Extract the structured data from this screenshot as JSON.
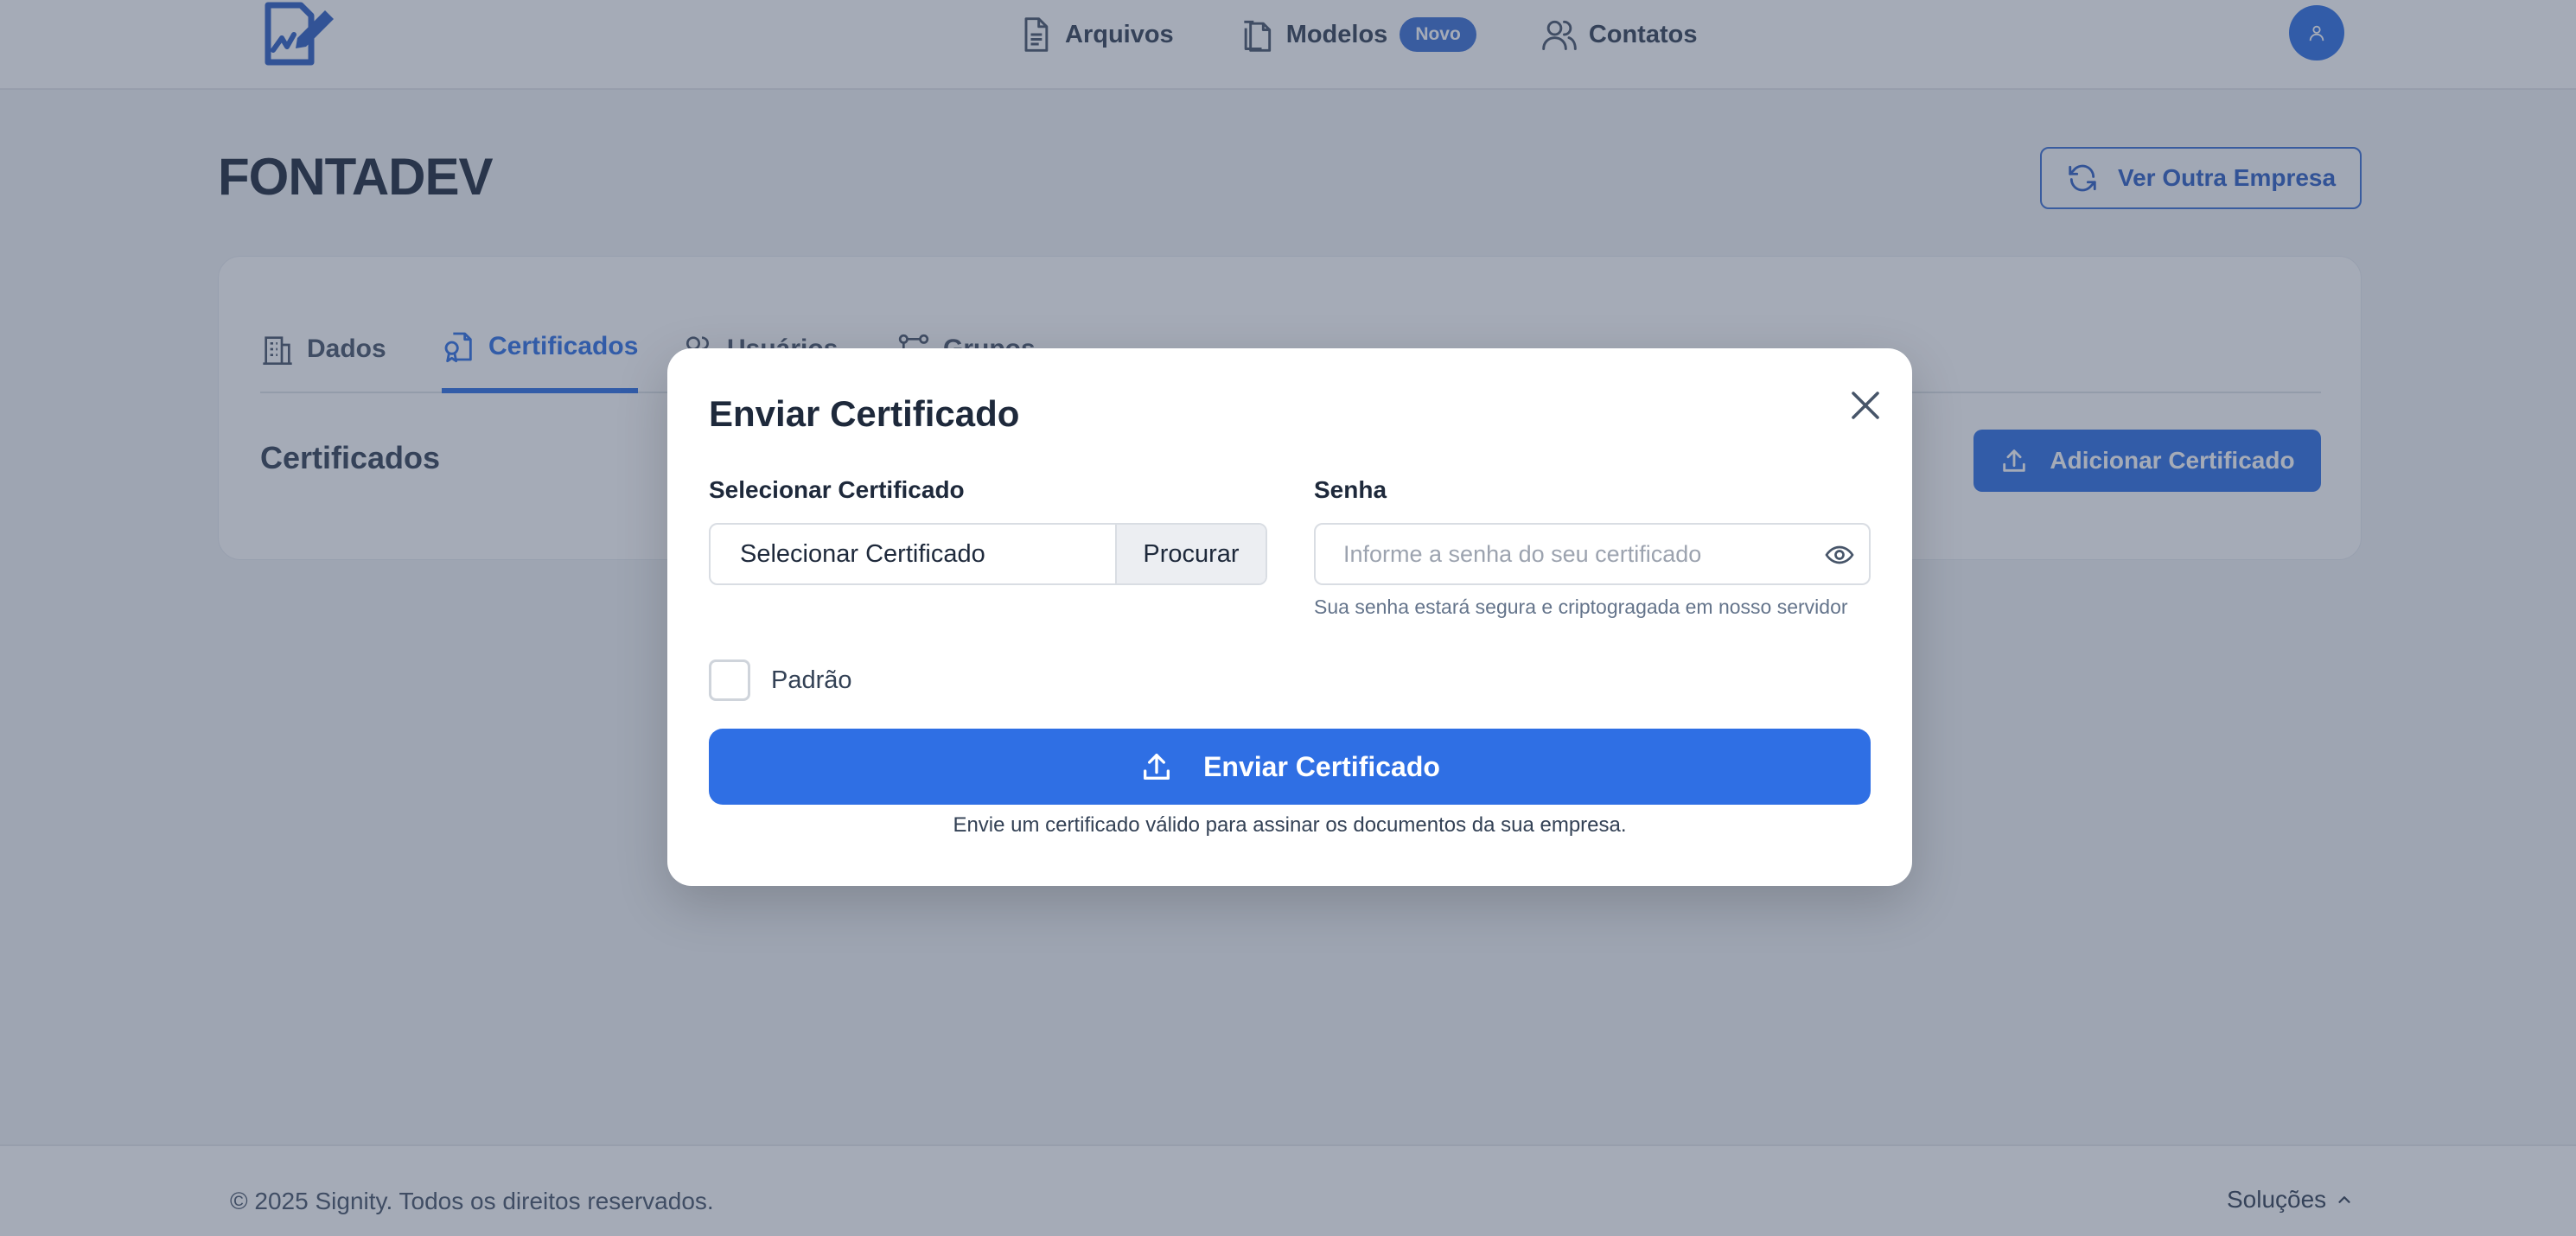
{
  "header": {
    "nav": [
      {
        "label": "Arquivos",
        "icon": "document-icon"
      },
      {
        "label": "Modelos",
        "icon": "documents-icon",
        "badge": "Novo"
      },
      {
        "label": "Contatos",
        "icon": "users-icon"
      }
    ]
  },
  "page": {
    "company_name": "FONTADEV",
    "switch_company_label": "Ver Outra Empresa",
    "tabs": [
      {
        "label": "Dados",
        "icon": "building-icon"
      },
      {
        "label": "Certificados",
        "icon": "certificate-icon",
        "active": true
      },
      {
        "label": "Usuários",
        "icon": "users-icon"
      },
      {
        "label": "Grupos",
        "icon": "groups-icon"
      }
    ],
    "section_title": "Certificados",
    "add_certificate_label": "Adicionar Certificado"
  },
  "modal": {
    "title": "Enviar Certificado",
    "certificate_label": "Selecionar Certificado",
    "file_value": "Selecionar Certificado",
    "browse_label": "Procurar",
    "password_label": "Senha",
    "password_placeholder": "Informe a senha do seu certificado",
    "password_hint": "Sua senha estará segura e criptogragada em nosso servidor",
    "default_label": "Padrão",
    "default_checked": false,
    "submit_label": "Enviar Certificado",
    "note": "Envie um certificado válido para assinar os documentos da sua empresa."
  },
  "footer": {
    "copyright": "© 2025 Signity. Todos os direitos reservados.",
    "solutions_label": "Soluções"
  },
  "colors": {
    "primary": "#2f6fe4",
    "overlay": "rgba(55, 68, 96, 0.45)",
    "text_dark": "#1e293b"
  }
}
